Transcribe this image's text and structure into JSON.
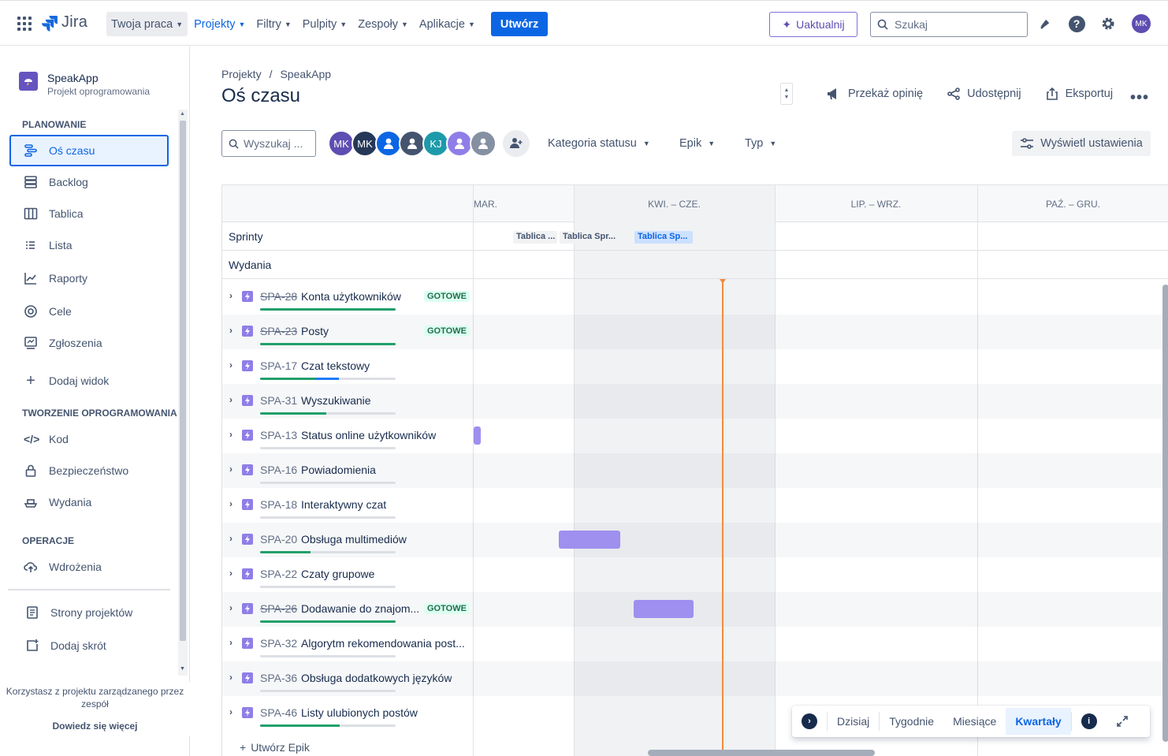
{
  "topbar": {
    "logo": "Jira",
    "nav": [
      "Twoja praca",
      "Projekty",
      "Filtry",
      "Pulpity",
      "Zespoły",
      "Aplikacje"
    ],
    "create": "Utwórz",
    "upgrade": "Uaktualnij",
    "search_placeholder": "Szukaj",
    "avatar": "MK"
  },
  "sidebar": {
    "project_name": "SpeakApp",
    "project_sub": "Projekt oprogramowania",
    "sections": {
      "planning": "PLANOWANIE",
      "dev": "TWORZENIE OPROGRAMOWANIA",
      "ops": "OPERACJE"
    },
    "items": {
      "timeline": "Oś czasu",
      "backlog": "Backlog",
      "board": "Tablica",
      "list": "Lista",
      "reports": "Raporty",
      "goals": "Cele",
      "issues": "Zgłoszenia",
      "add_view": "Dodaj widok",
      "code": "Kod",
      "security": "Bezpieczeństwo",
      "releases": "Wydania",
      "deployments": "Wdrożenia",
      "project_pages": "Strony projektów",
      "add_shortcut": "Dodaj skrót"
    },
    "footer_text": "Korzystasz z projektu zarządzanego przez zespół",
    "footer_link": "Dowiedz się więcej"
  },
  "header": {
    "breadcrumb_1": "Projekty",
    "breadcrumb_sep": "/",
    "breadcrumb_2": "SpeakApp",
    "title": "Oś czasu",
    "feedback": "Przekaż opinię",
    "share": "Udostępnij",
    "export": "Eksportuj"
  },
  "filters": {
    "search_placeholder": "Wyszukaj ...",
    "avatars": [
      {
        "label": "MK",
        "color": "#5e4db2"
      },
      {
        "label": "MK",
        "color": "#253858"
      },
      {
        "label": "",
        "color": "#0c66e4"
      },
      {
        "label": "",
        "color": "#44546f"
      },
      {
        "label": "KJ",
        "color": "#1d9aaa"
      },
      {
        "label": "",
        "color": "#8f7ee7"
      },
      {
        "label": "",
        "color": "#8590a2"
      }
    ],
    "status_category": "Kategoria statusu",
    "epic": "Epik",
    "type": "Typ",
    "view_settings": "Wyświetl ustawienia"
  },
  "timeline": {
    "quarters": [
      "MAR.",
      "KWI. – CZE.",
      "LIP. – WRZ.",
      "PAŹ. – GRU."
    ],
    "sprints_label": "Sprinty",
    "releases_label": "Wydania",
    "sprints": [
      "Tablica ...",
      "Tablica Spr...",
      "Tablica Sp..."
    ],
    "create_epic": "Utwórz Epik",
    "epics": [
      {
        "key": "SPA-28",
        "title": "Konta użytkowników",
        "badge": "GOTOWE",
        "done": true,
        "progress_done": 1.0,
        "progress_ip": 0
      },
      {
        "key": "SPA-23",
        "title": "Posty",
        "badge": "GOTOWE",
        "done": true,
        "progress_done": 1.0,
        "progress_ip": 0
      },
      {
        "key": "SPA-17",
        "title": "Czat tekstowy",
        "badge": "",
        "done": false,
        "progress_done": 0.41,
        "progress_ip": 0.17
      },
      {
        "key": "SPA-31",
        "title": "Wyszukiwanie",
        "badge": "",
        "done": false,
        "progress_done": 0.49,
        "progress_ip": 0
      },
      {
        "key": "SPA-13",
        "title": "Status online użytkowników",
        "badge": "",
        "done": false,
        "progress_done": 0,
        "progress_ip": 0
      },
      {
        "key": "SPA-16",
        "title": "Powiadomienia",
        "badge": "",
        "done": false,
        "progress_done": 0,
        "progress_ip": 0
      },
      {
        "key": "SPA-18",
        "title": "Interaktywny czat",
        "badge": "",
        "done": false,
        "progress_done": 0,
        "progress_ip": 0
      },
      {
        "key": "SPA-20",
        "title": "Obsługa multimediów",
        "badge": "",
        "done": false,
        "progress_done": 0.37,
        "progress_ip": 0
      },
      {
        "key": "SPA-22",
        "title": "Czaty grupowe",
        "badge": "",
        "done": false,
        "progress_done": 0,
        "progress_ip": 0
      },
      {
        "key": "SPA-26",
        "title": "Dodawanie do znajom...",
        "badge": "GOTOWE",
        "done": true,
        "progress_done": 1.0,
        "progress_ip": 0
      },
      {
        "key": "SPA-32",
        "title": "Algorytm rekomendowania post...",
        "badge": "",
        "done": false,
        "progress_done": 0,
        "progress_ip": 0
      },
      {
        "key": "SPA-36",
        "title": "Obsługa dodatkowych języków",
        "badge": "",
        "done": false,
        "progress_done": 0,
        "progress_ip": 0
      },
      {
        "key": "SPA-46",
        "title": "Listy ulubionych postów",
        "badge": "",
        "done": false,
        "progress_done": 0.59,
        "progress_ip": 0
      }
    ]
  },
  "zoom": {
    "today": "Dzisiaj",
    "weeks": "Tygodnie",
    "months": "Miesiące",
    "quarters": "Kwartały"
  }
}
